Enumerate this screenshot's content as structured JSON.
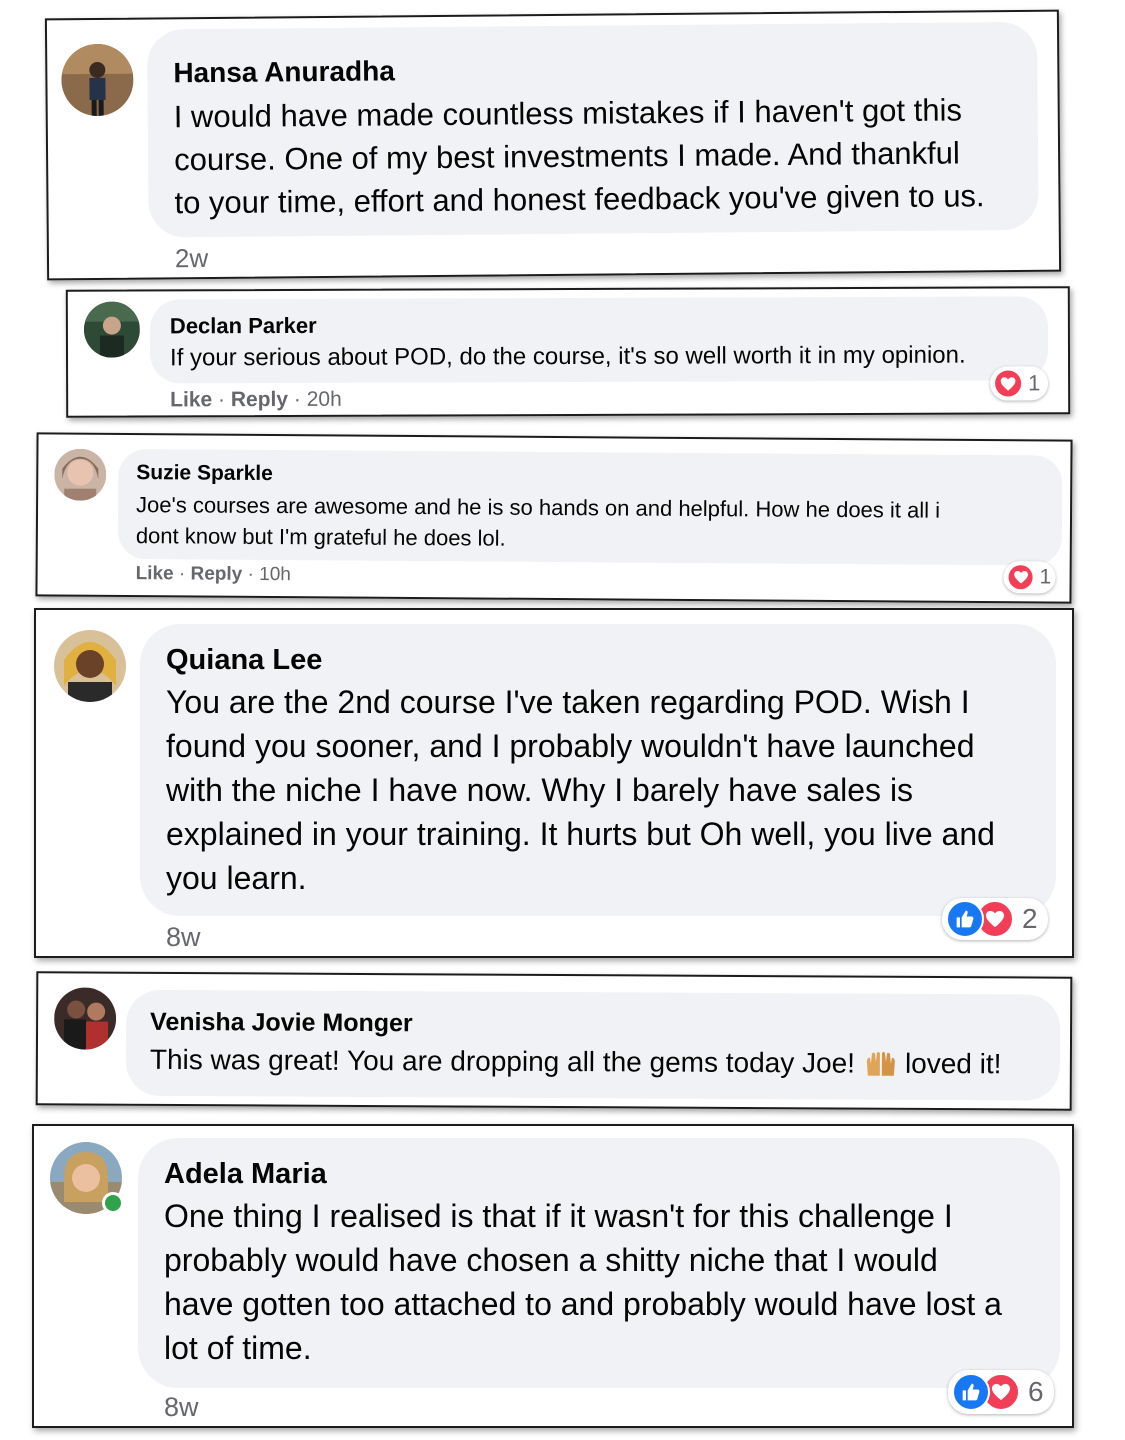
{
  "comments": [
    {
      "name": "Hansa Anuradha",
      "text": "I would have made countless mistakes if I haven't got this\ncourse. One of my best investments I made. And thankful\nto your time, effort and honest feedback you've given to us.",
      "time": "2w"
    },
    {
      "name": "Declan Parker",
      "text": "If your serious about POD, do the course, it's so well worth it in my opinion.",
      "like": "Like",
      "reply": "Reply",
      "time": "20h",
      "reaction_count": "1"
    },
    {
      "name": "Suzie Sparkle",
      "text": "Joe's courses are awesome and he is so hands on and helpful. How he does it all i\ndont know but I'm grateful he does lol.",
      "like": "Like",
      "reply": "Reply",
      "time": "10h",
      "reaction_count": "1"
    },
    {
      "name": "Quiana Lee",
      "text": "You are the 2nd course I've taken regarding POD. Wish I\nfound you sooner, and I probably wouldn't have launched\nwith the niche I have now. Why I barely have sales is\nexplained in your training. It hurts but Oh well, you live and\nyou learn.",
      "time": "8w",
      "reaction_count": "2"
    },
    {
      "name": "Venisha Jovie Monger",
      "text_before": "This was great! You are dropping all the gems today Joe!",
      "text_after": "loved it!"
    },
    {
      "name": "Adela Maria",
      "text": "One thing I realised is that if it wasn't for this challenge I\nprobably would have chosen a shitty niche that I would\nhave gotten too attached to and probably would have lost a\nlot of time.",
      "time": "8w",
      "reaction_count": "6"
    }
  ],
  "colors": {
    "bubble": "#f0f2f5",
    "meta_text": "#65676b",
    "love": "#f33e58",
    "like": "#1877f2",
    "online": "#31a24c"
  },
  "icons": [
    "heart-reaction-icon",
    "like-reaction-icon",
    "raising-hands-emoji-icon",
    "online-status-icon"
  ]
}
